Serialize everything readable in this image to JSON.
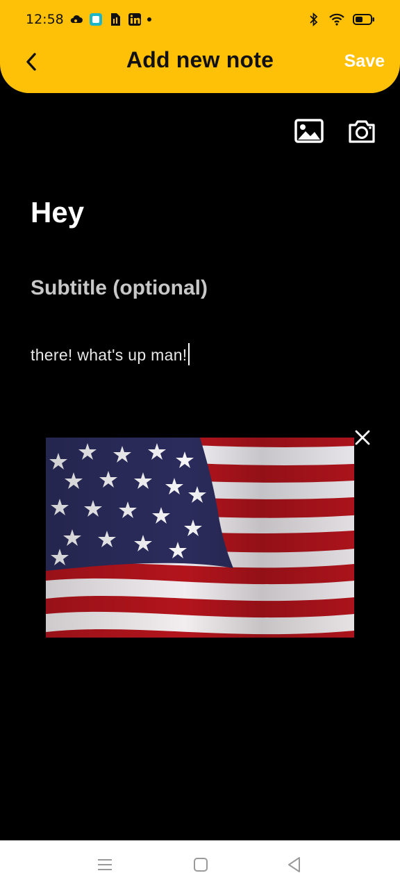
{
  "status_bar": {
    "time": "12:58",
    "left_icons": [
      "cloud-icon",
      "app-icon",
      "sim-icon",
      "linkedin-icon",
      "dot-icon"
    ],
    "right_icons": [
      "bluetooth-icon",
      "wifi-icon",
      "battery-icon"
    ]
  },
  "header": {
    "title": "Add new note",
    "save_label": "Save",
    "back_icon": "chevron-left-icon",
    "background": "#FFC107"
  },
  "toolbar": {
    "icons": [
      "image-gallery-icon",
      "camera-icon"
    ]
  },
  "note": {
    "title": "Hey",
    "subtitle_placeholder": "Subtitle (optional)",
    "body": "there! what's up man!"
  },
  "attachment": {
    "image": "american-flag-image",
    "remove_icon": "close-icon"
  },
  "nav_bar": {
    "icons": [
      "menu-icon",
      "home-icon",
      "back-icon"
    ]
  }
}
